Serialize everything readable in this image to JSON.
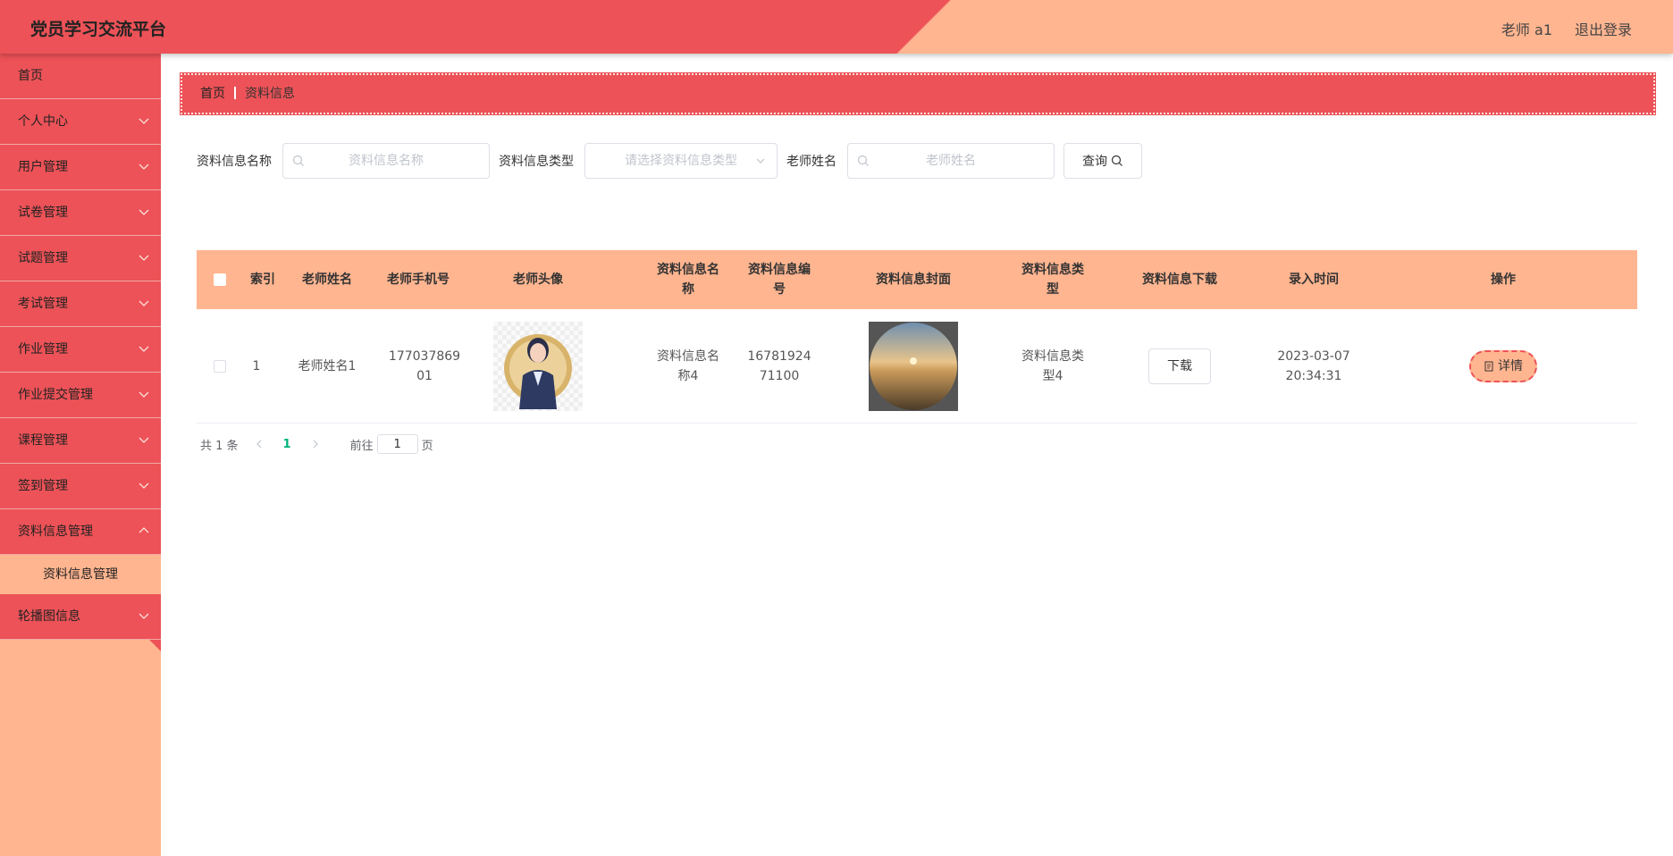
{
  "header": {
    "title": "党员学习交流平台",
    "user": "老师 a1",
    "logout": "退出登录"
  },
  "sidebar": {
    "items": [
      {
        "label": "首页",
        "has_chevron": false
      },
      {
        "label": "个人中心",
        "has_chevron": true
      },
      {
        "label": "用户管理",
        "has_chevron": true
      },
      {
        "label": "试卷管理",
        "has_chevron": true
      },
      {
        "label": "试题管理",
        "has_chevron": true
      },
      {
        "label": "考试管理",
        "has_chevron": true
      },
      {
        "label": "作业管理",
        "has_chevron": true
      },
      {
        "label": "作业提交管理",
        "has_chevron": true
      },
      {
        "label": "课程管理",
        "has_chevron": true
      },
      {
        "label": "签到管理",
        "has_chevron": true
      },
      {
        "label": "资料信息管理",
        "has_chevron": true,
        "expanded": true
      },
      {
        "label": "轮播图信息",
        "has_chevron": true
      }
    ],
    "sub_item": "资料信息管理"
  },
  "breadcrumb": {
    "home": "首页",
    "current": "资料信息"
  },
  "search": {
    "name_label": "资料信息名称",
    "name_placeholder": "资料信息名称",
    "type_label": "资料信息类型",
    "type_placeholder": "请选择资料信息类型",
    "teacher_label": "老师姓名",
    "teacher_placeholder": "老师姓名",
    "query_button": "查询"
  },
  "table": {
    "headers": {
      "index": "索引",
      "teacher_name": "老师姓名",
      "teacher_phone": "老师手机号",
      "teacher_avatar": "老师头像",
      "name": "资料信息名称",
      "code": "资料信息编号",
      "cover": "资料信息封面",
      "type": "资料信息类型",
      "download": "资料信息下载",
      "time": "录入时间",
      "action": "操作"
    },
    "rows": [
      {
        "index": "1",
        "teacher_name": "老师姓名1",
        "teacher_phone": "17703786901",
        "name": "资料信息名称4",
        "code": "1678192471100",
        "type": "资料信息类型4",
        "download_label": "下载",
        "time": "2023-03-07 20:34:31",
        "detail_label": "详情"
      }
    ]
  },
  "pager": {
    "total": "共 1 条",
    "current_page": "1",
    "goto_prefix": "前往",
    "goto_value": "1",
    "goto_suffix": "页"
  },
  "colors": {
    "primary": "#ec5257",
    "secondary": "#ffb590",
    "active_page": "#00b27a"
  }
}
